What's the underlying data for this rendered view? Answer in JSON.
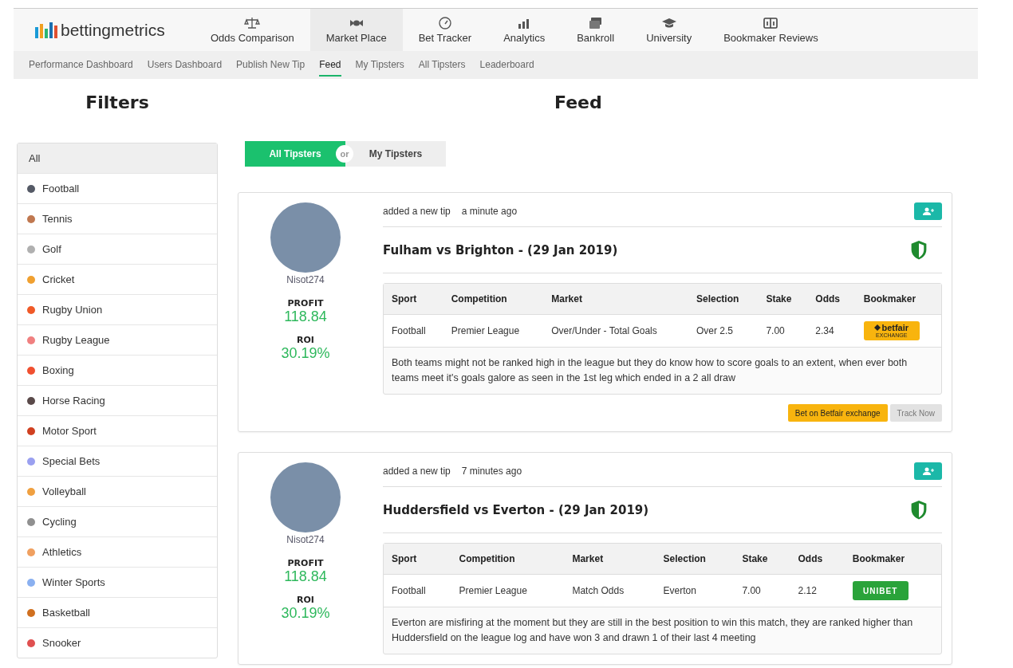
{
  "brand": {
    "name": "bettingmetrics"
  },
  "nav": [
    {
      "label": "Odds Comparison",
      "selected": false
    },
    {
      "label": "Market Place",
      "selected": true
    },
    {
      "label": "Bet Tracker",
      "selected": false
    },
    {
      "label": "Analytics",
      "selected": false
    },
    {
      "label": "Bankroll",
      "selected": false
    },
    {
      "label": "University",
      "selected": false
    },
    {
      "label": "Bookmaker Reviews",
      "selected": false
    }
  ],
  "subnav": [
    {
      "label": "Performance Dashboard",
      "selected": false
    },
    {
      "label": "Users Dashboard",
      "selected": false
    },
    {
      "label": "Publish New Tip",
      "selected": false
    },
    {
      "label": "Feed",
      "selected": true
    },
    {
      "label": "My Tipsters",
      "selected": false
    },
    {
      "label": "All Tipsters",
      "selected": false
    },
    {
      "label": "Leaderboard",
      "selected": false
    }
  ],
  "filters": {
    "title": "Filters",
    "items": [
      {
        "label": "All",
        "selected": true
      },
      {
        "label": "Football",
        "selected": false,
        "color": "#555a66"
      },
      {
        "label": "Tennis",
        "selected": false,
        "color": "#c07850"
      },
      {
        "label": "Golf",
        "selected": false,
        "color": "#b0b0b0"
      },
      {
        "label": "Cricket",
        "selected": false,
        "color": "#f0a030"
      },
      {
        "label": "Rugby Union",
        "selected": false,
        "color": "#f05a28"
      },
      {
        "label": "Rugby League",
        "selected": false,
        "color": "#f08080"
      },
      {
        "label": "Boxing",
        "selected": false,
        "color": "#f05030"
      },
      {
        "label": "Horse Racing",
        "selected": false,
        "color": "#5a4a4a"
      },
      {
        "label": "Motor Sport",
        "selected": false,
        "color": "#d04020"
      },
      {
        "label": "Special Bets",
        "selected": false,
        "color": "#9aa0f0"
      },
      {
        "label": "Volleyball",
        "selected": false,
        "color": "#f0a040"
      },
      {
        "label": "Cycling",
        "selected": false,
        "color": "#909090"
      },
      {
        "label": "Athletics",
        "selected": false,
        "color": "#f0a060"
      },
      {
        "label": "Winter Sports",
        "selected": false,
        "color": "#8ab0f0"
      },
      {
        "label": "Basketball",
        "selected": false,
        "color": "#d07020"
      },
      {
        "label": "Snooker",
        "selected": false,
        "color": "#e05050"
      }
    ]
  },
  "feed": {
    "title": "Feed",
    "toggle": {
      "options": [
        {
          "label": "All Tipsters",
          "selected": true
        },
        {
          "label": "My Tipsters",
          "selected": false
        }
      ],
      "separator": "or"
    },
    "tips": [
      {
        "user": "Nisot274",
        "profit_label": "PROFIT",
        "profit": "118.84",
        "roi_label": "ROI",
        "roi": "30.19%",
        "action": "added a new tip",
        "time": "a minute ago",
        "title": "Fulham vs Brighton - (29 Jan 2019)",
        "columns": [
          "Sport",
          "Competition",
          "Market",
          "Selection",
          "Stake",
          "Odds",
          "Bookmaker"
        ],
        "cells": [
          "Football",
          "Premier League",
          "Over/Under - Total Goals",
          "Over 2.5",
          "7.00",
          "2.34"
        ],
        "bookmaker": {
          "kind": "betfair",
          "name": "betfair",
          "sub": "EXCHANGE"
        },
        "description": "Both teams might not be ranked high in the league but they do know how to score goals to an extent, when ever both teams meet it's goals galore as seen in the 1st leg which ended in a 2 all draw",
        "buttons": [
          "Bet on Betfair exchange",
          "Track Now"
        ]
      },
      {
        "user": "Nisot274",
        "profit_label": "PROFIT",
        "profit": "118.84",
        "roi_label": "ROI",
        "roi": "30.19%",
        "action": "added a new tip",
        "time": "7 minutes ago",
        "title": "Huddersfield vs Everton - (29 Jan 2019)",
        "columns": [
          "Sport",
          "Competition",
          "Market",
          "Selection",
          "Stake",
          "Odds",
          "Bookmaker"
        ],
        "cells": [
          "Football",
          "Premier League",
          "Match Odds",
          "Everton",
          "7.00",
          "2.12"
        ],
        "bookmaker": {
          "kind": "unibet",
          "name": "UNIBET"
        },
        "description": "Everton are misfiring at the moment but they are still in the best position to win this match, they are ranked higher than Huddersfield on the league log and have won 3 and drawn 1 of their last 4 meeting"
      }
    ]
  }
}
